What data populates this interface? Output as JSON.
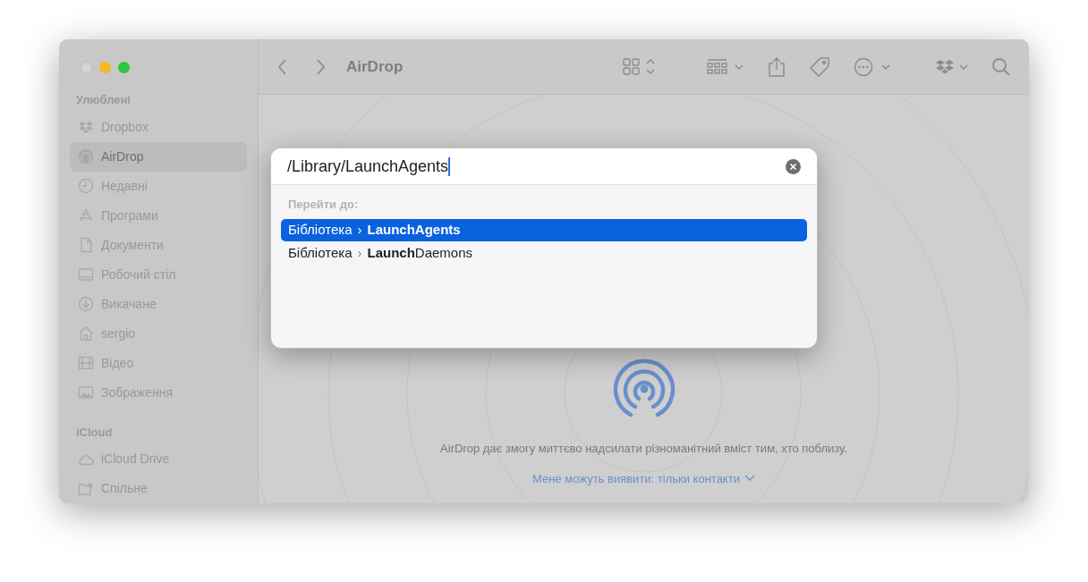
{
  "window": {
    "title": "AirDrop"
  },
  "sidebar": {
    "sections": [
      {
        "title": "Улюблені",
        "items": [
          {
            "label": "Dropbox",
            "selected": false
          },
          {
            "label": "AirDrop",
            "selected": true
          },
          {
            "label": "Недавні",
            "selected": false
          },
          {
            "label": "Програми",
            "selected": false
          },
          {
            "label": "Документи",
            "selected": false
          },
          {
            "label": "Робочий стіл",
            "selected": false
          },
          {
            "label": "Викачане",
            "selected": false
          },
          {
            "label": "sergio",
            "selected": false
          },
          {
            "label": "Відео",
            "selected": false
          },
          {
            "label": "Зображення",
            "selected": false
          }
        ]
      },
      {
        "title": "iCloud",
        "items": [
          {
            "label": "iCloud Drive",
            "selected": false
          },
          {
            "label": "Спільне",
            "selected": false
          }
        ]
      }
    ]
  },
  "goto_dialog": {
    "value": "/Library/LaunchAgents",
    "section_title": "Перейти до:",
    "suggestions": [
      {
        "parent": "Бібліотека",
        "separator": "›",
        "name": "**LaunchAgents**",
        "selected": true
      },
      {
        "parent": "Бібліотека",
        "separator": "›",
        "name": "**Launch**Daemons",
        "selected": false
      }
    ]
  },
  "airdrop": {
    "description": "AirDrop дає змогу миттєво надсилати різноманітний вміст тим, хто поблизу.",
    "discovery": "Мене можуть виявити: тільки контакти"
  }
}
